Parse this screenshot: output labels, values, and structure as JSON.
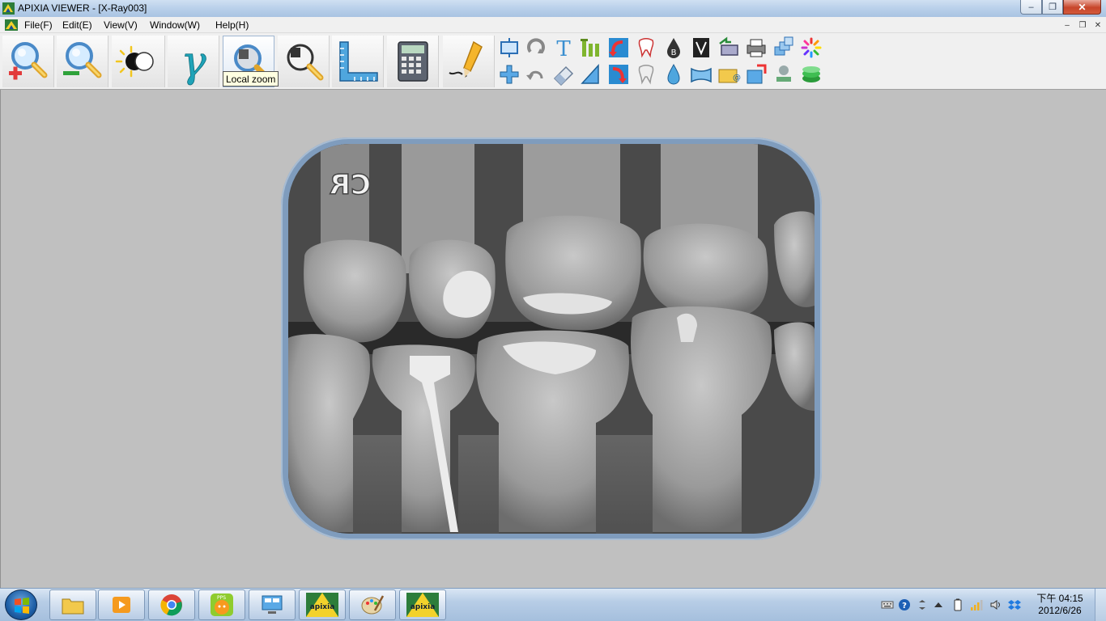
{
  "window": {
    "title": "APIXIA VIEWER - [X-Ray003]",
    "minimize_glyph": "–",
    "maximize_glyph": "❐",
    "close_glyph": "✕"
  },
  "menu": {
    "items": [
      "File(F)",
      "Edit(E)",
      "View(V)",
      "Window(W)",
      "Help(H)"
    ],
    "mdi_minimize": "–",
    "mdi_restore": "❐",
    "mdi_close": "✕"
  },
  "toolbar": {
    "big_buttons": [
      "zoom-in",
      "zoom-out",
      "brightness-contrast",
      "gamma",
      "local-zoom",
      "magnifier",
      "ruler-measure",
      "calculator",
      "pencil-draw"
    ],
    "tooltip": "Local zoom",
    "gamma_symbol": "γ",
    "text_tool_letter": "T",
    "density_letter": "B"
  },
  "image": {
    "marker_text": "CR"
  },
  "taskbar": {
    "pinned": [
      "file-explorer",
      "media-player",
      "chrome",
      "pps",
      "remote-desktop",
      "apixia",
      "paint",
      "apixia"
    ],
    "apixia_label": "apixia",
    "pps_label": "PPS",
    "clock_time": "下午 04:15",
    "clock_date": "2012/6/26"
  },
  "colors": {
    "titlebar": "#b9d0ea",
    "workspace": "#c0c0c0",
    "frame": "#7f9cbd",
    "tooltip": "#ffffe1"
  }
}
